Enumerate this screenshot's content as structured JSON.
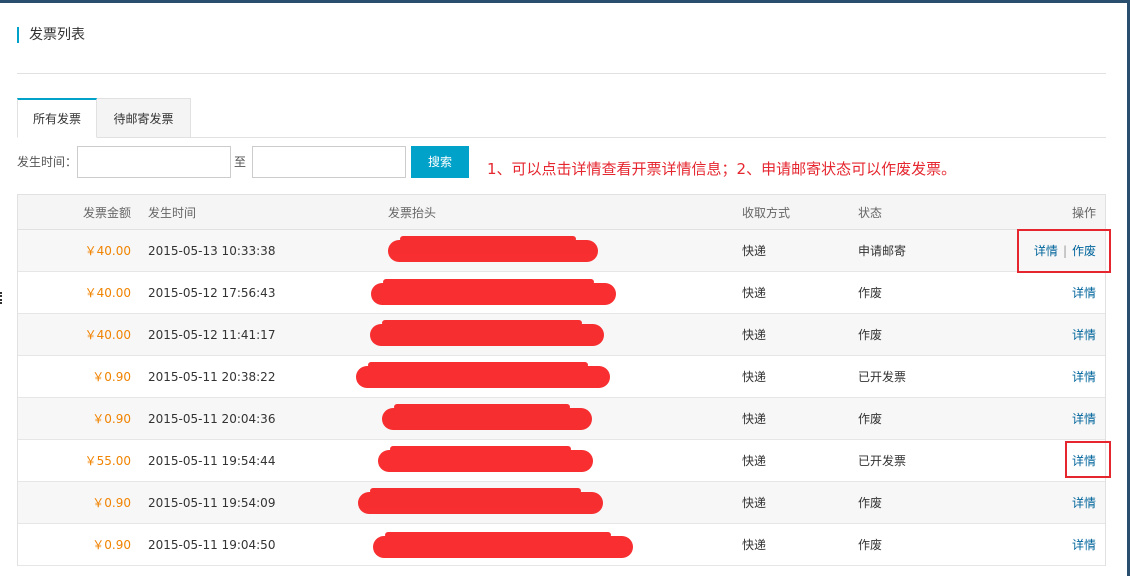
{
  "page": {
    "title": "发票列表"
  },
  "tabs": [
    {
      "label": "所有发票",
      "active": true
    },
    {
      "label": "待邮寄发票",
      "active": false
    }
  ],
  "filter": {
    "label": "发生时间：",
    "start_value": "",
    "end_value": "",
    "to_label": "至",
    "search_label": "搜索"
  },
  "annotation": "1、可以点击详情查看开票详情信息；2、申请邮寄状态可以作废发票。",
  "table": {
    "headers": {
      "amount": "发票金额",
      "time": "发生时间",
      "title": "发票抬头",
      "method": "收取方式",
      "status": "状态",
      "ops": "操作"
    },
    "rows": [
      {
        "amount": "￥40.00",
        "time": "2015-05-13 10:33:38",
        "method": "快递",
        "status": "申请邮寄",
        "detail": "详情",
        "void": "作废"
      },
      {
        "amount": "￥40.00",
        "time": "2015-05-12 17:56:43",
        "method": "快递",
        "status": "作废",
        "detail": "详情"
      },
      {
        "amount": "￥40.00",
        "time": "2015-05-12 11:41:17",
        "method": "快递",
        "status": "作废",
        "detail": "详情"
      },
      {
        "amount": "￥0.90",
        "time": "2015-05-11 20:38:22",
        "method": "快递",
        "status": "已开发票",
        "detail": "详情"
      },
      {
        "amount": "￥0.90",
        "time": "2015-05-11 20:04:36",
        "method": "快递",
        "status": "作废",
        "detail": "详情"
      },
      {
        "amount": "￥55.00",
        "time": "2015-05-11 19:54:44",
        "method": "快递",
        "status": "已开发票",
        "detail": "详情"
      },
      {
        "amount": "￥0.90",
        "time": "2015-05-11 19:54:09",
        "method": "快递",
        "status": "作废",
        "detail": "详情"
      },
      {
        "amount": "￥0.90",
        "time": "2015-05-11 19:04:50",
        "method": "快递",
        "status": "作废",
        "detail": "详情"
      }
    ]
  },
  "colors": {
    "accent": "#00a2ca",
    "amount": "#f08300",
    "link": "#00659c",
    "annotation_red": "#e5262f"
  }
}
